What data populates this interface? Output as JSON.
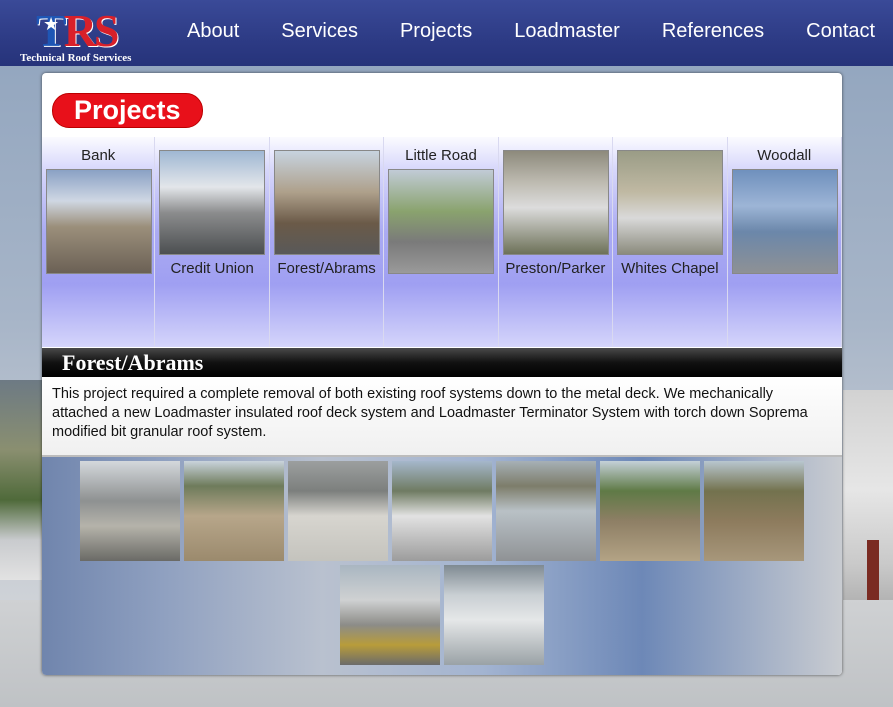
{
  "header": {
    "logo_text": "TRS",
    "logo_tagline": "Technical Roof Services",
    "nav": [
      "About",
      "Services",
      "Projects",
      "Loadmaster",
      "References",
      "Contact"
    ]
  },
  "page": {
    "title": "Projects"
  },
  "projects": [
    {
      "caption": "Bank",
      "position": "top"
    },
    {
      "caption": "Credit Union",
      "position": "bottom"
    },
    {
      "caption": "Forest/Abrams",
      "position": "bottom"
    },
    {
      "caption": "Little Road",
      "position": "top"
    },
    {
      "caption": "Preston/Parker",
      "position": "bottom"
    },
    {
      "caption": "Whites Chapel",
      "position": "bottom"
    },
    {
      "caption": "Woodall",
      "position": "top"
    }
  ],
  "detail": {
    "title": "Forest/Abrams",
    "description": "This project required a complete removal of both existing roof systems down to the metal deck. We mechanically attached a new Loadmaster insulated roof deck system and Loadmaster Terminator System with torch down Soprema modified bit granular roof system."
  },
  "gallery": {
    "count": 9
  }
}
